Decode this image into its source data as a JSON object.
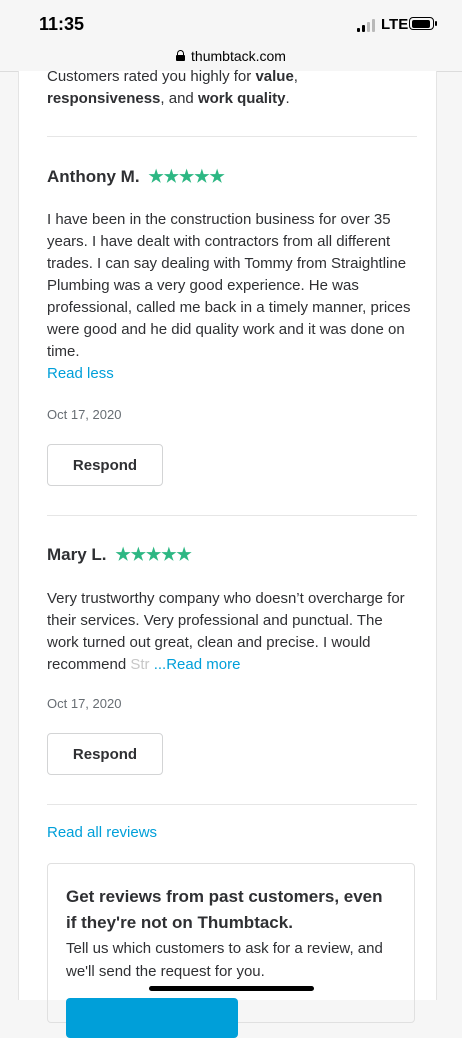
{
  "status": {
    "time": "11:35",
    "network": "LTE"
  },
  "browser": {
    "url": "thumbtack.com"
  },
  "summary": {
    "prefix": "Customers rated you highly for ",
    "attr1": "value",
    "sep1": ", ",
    "attr2": "responsiveness",
    "sep2": ", and ",
    "attr3": "work quality",
    "suffix": "."
  },
  "reviews": [
    {
      "name": "Anthony M.",
      "stars": "★★★★★",
      "text": "I have been in the construction business for over 35 years. I have dealt with contractors from all different trades. I can say dealing with Tommy from Straightline Plumbing was a very good experience. He was professional, called me back in a timely manner, prices were good and he did quality work and it was done on time.",
      "toggle": "Read less",
      "date": "Oct 17, 2020",
      "respond": "Respond"
    },
    {
      "name": "Mary L.",
      "stars": "★★★★★",
      "text": "Very trustworthy company who doesn’t overcharge for their services. Very professional and punctual. The work turned out great, clean and precise. I would recommend ",
      "faded": "Str",
      "toggle": "...Read more",
      "date": "Oct 17, 2020",
      "respond": "Respond"
    }
  ],
  "read_all": "Read all reviews",
  "promo": {
    "title": "Get reviews from past customers, even if they're not on Thumbtack.",
    "text": "Tell us which customers to ask for a review, and we'll send the request for you."
  },
  "colors": {
    "accent": "#009fd9",
    "stars": "#2db783"
  }
}
